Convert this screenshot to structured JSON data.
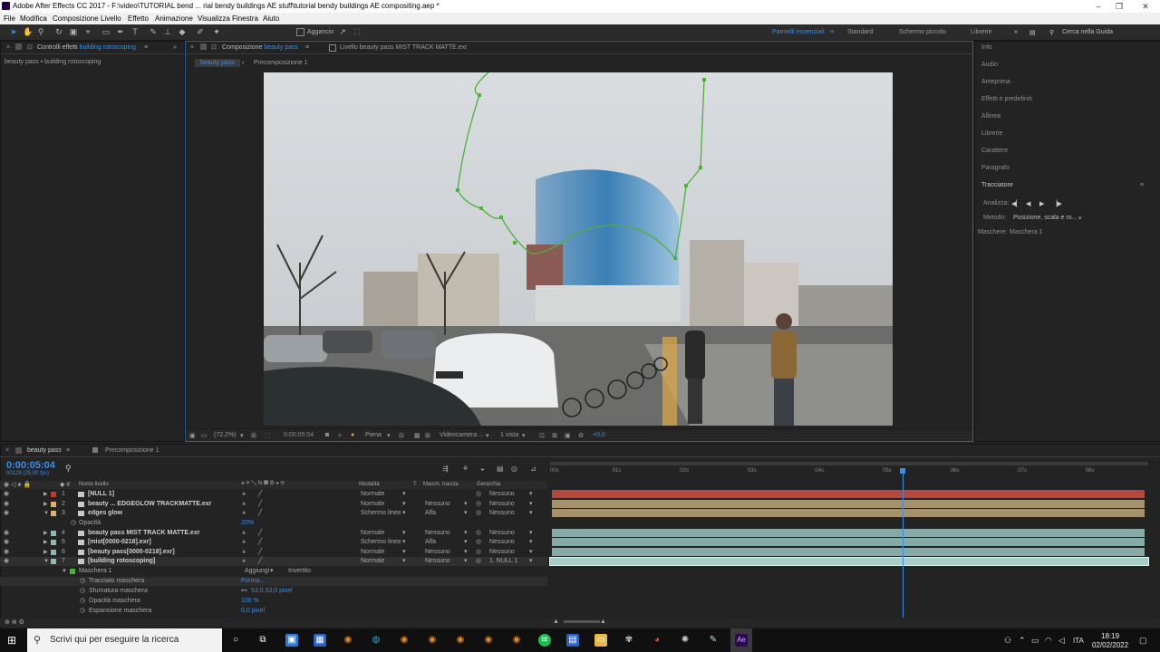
{
  "window": {
    "title": "Adobe After Effects CC 2017 - F:\\video\\TUTORIAL bend ... rial bendy buildings AE stuff\\tutorial bendy buildings AE compositing.aep *"
  },
  "menu": [
    "File",
    "Modifica",
    "Composizione",
    "Livello",
    "Effetto",
    "Animazione",
    "Visualizza",
    "Finestra",
    "Aiuto"
  ],
  "toolbar": {
    "snap_label": "Aggancio",
    "workspaces": [
      "Pannelli essenziali",
      "Standard",
      "Schermo piccolo",
      "Librerie"
    ],
    "search_placeholder": "Cerca nella Guida"
  },
  "effects_panel": {
    "tab": "Controlli effetti",
    "tab_layer": "building rotoscoping",
    "breadcrumb": "beauty pass • building rotoscoping"
  },
  "comp_panel": {
    "tab_prefix": "Composizione",
    "tab_name": "beauty pass",
    "layer_tab": "Livello beauty pass MIST TRACK MATTE.exr",
    "sub_tabs": [
      "beauty pass",
      "Precomposizione 1"
    ],
    "footer": {
      "zoom": "(72,2%)",
      "time": "0:00:05:04",
      "resolution": "Piena",
      "camera": "Videocamera ...",
      "views": "1 vista",
      "exposure": "+0,0"
    }
  },
  "right_panel": {
    "items": [
      "Info",
      "Audio",
      "Anteprima",
      "Effetti e predefiniti",
      "Allinea",
      "Librerie",
      "Carattere",
      "Paragrafo"
    ],
    "tracker": {
      "title": "Tracciatore",
      "analyze_label": "Analizza:",
      "method_label": "Metodo:",
      "method_value": "Posizione, scala e ro...",
      "masks_label": "Maschere:",
      "masks_value": "Maschera 1"
    }
  },
  "timeline": {
    "tabs": [
      "beauty pass",
      "Precomposizione 1"
    ],
    "timecode": "0:00:05:04",
    "frame_info": "00129 (25,00 fps)",
    "headers": {
      "name": "Nome livello",
      "mode": "Modalità",
      "t": "T",
      "matte": "Masch. traccia",
      "parent": "Gerarchia"
    },
    "layers": [
      {
        "num": "1",
        "name": "[NULL 1]",
        "mode": "Normale",
        "matte": "",
        "parent": "Nessuno",
        "label": "#c0392b",
        "bar": "#b5473f"
      },
      {
        "num": "2",
        "name": "beauty ... EDGEGLOW TRACKMATTE.exr",
        "mode": "Normale",
        "matte": "Nessuno",
        "parent": "Nessuno",
        "label": "#d9b16a",
        "bar": "#a5926c"
      },
      {
        "num": "3",
        "name": "edges glow",
        "mode": "Schermo lineare",
        "matte": "Alfa",
        "parent": "Nessuno",
        "label": "#d9b16a",
        "bar": "#a5926c"
      },
      {
        "num": "4",
        "name": "beauty pass MIST TRACK MATTE.exr",
        "mode": "Normale",
        "matte": "Nessuno",
        "parent": "Nessuno",
        "label": "#8fb8b5",
        "bar": "#86aaa6"
      },
      {
        "num": "5",
        "name": "[mist[0000-0218].exr]",
        "mode": "Schermo lineare",
        "matte": "Alfa",
        "parent": "Nessuno",
        "label": "#8fb8b5",
        "bar": "#86aaa6"
      },
      {
        "num": "6",
        "name": "[beauty pass[0000-0218].exr]",
        "mode": "Normale",
        "matte": "Nessuno",
        "parent": "Nessuno",
        "label": "#8fb8b5",
        "bar": "#86aaa6"
      },
      {
        "num": "7",
        "name": "[building rotoscoping]",
        "mode": "Normale",
        "matte": "Nessuno",
        "parent": "1. NULL 1",
        "label": "#8fb8b5",
        "bar": "#a6cfc9"
      }
    ],
    "opacity_row": {
      "label": "Opacità",
      "value": "20%"
    },
    "mask": {
      "name": "Maschera 1",
      "mode": "Aggiungi",
      "inverted": "Invertito",
      "props": [
        {
          "label": "Tracciato maschera",
          "value": "Forma..."
        },
        {
          "label": "Sfumatura maschera",
          "value": "53,0,53,0 pixel"
        },
        {
          "label": "Opacità maschera",
          "value": "100 %"
        },
        {
          "label": "Espansione maschera",
          "value": "0,0 pixel"
        }
      ]
    },
    "ruler": [
      "00s",
      "01s",
      "02s",
      "03s",
      "04s",
      "05s",
      "06s",
      "07s",
      "08s"
    ],
    "playhead_seconds": 5.17
  },
  "taskbar": {
    "search": "Scrivi qui per eseguire la ricerca",
    "lang": "ITA",
    "time": "18:19",
    "date": "02/02/2022"
  },
  "colors": {
    "accent": "#3a8ee6",
    "bg": "#232323"
  }
}
